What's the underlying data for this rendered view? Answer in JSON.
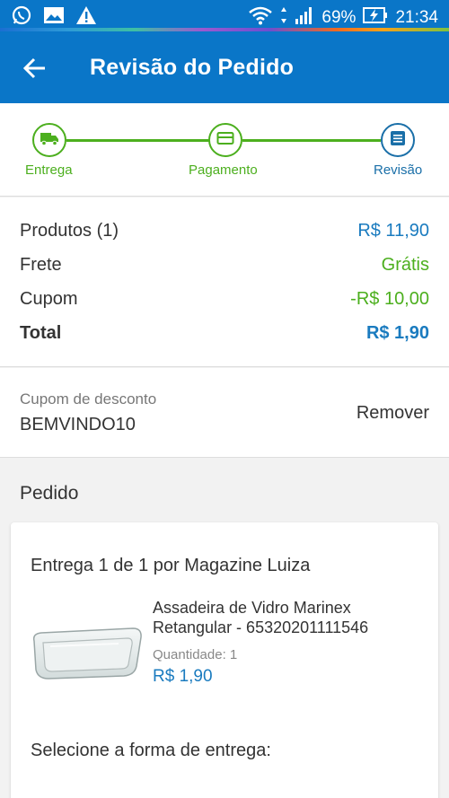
{
  "status_bar": {
    "battery": "69%",
    "time": "21:34"
  },
  "app_bar": {
    "title": "Revisão do Pedido"
  },
  "stepper": {
    "steps": [
      {
        "label": "Entrega",
        "icon": "truck-icon"
      },
      {
        "label": "Pagamento",
        "icon": "card-icon"
      },
      {
        "label": "Revisão",
        "icon": "list-icon"
      }
    ]
  },
  "summary": {
    "products_label": "Produtos (1)",
    "products_value": "R$ 11,90",
    "shipping_label": "Frete",
    "shipping_value": "Grátis",
    "coupon_label": "Cupom",
    "coupon_value": "-R$ 10,00",
    "total_label": "Total",
    "total_value": "R$ 1,90"
  },
  "coupon": {
    "label": "Cupom de desconto",
    "code": "BEMVINDO10",
    "remove_label": "Remover"
  },
  "order": {
    "section_title": "Pedido",
    "delivery_title": "Entrega 1 de 1 por Magazine Luiza",
    "product_name": "Assadeira de Vidro Marinex Retangular - 65320201111546",
    "quantity_label": "Quantidade:",
    "quantity": "1",
    "price": "R$ 1,90",
    "select_delivery_title": "Selecione a forma de entrega:"
  },
  "colors": {
    "brand_blue": "#0a76c8",
    "green": "#4caf1e",
    "price_blue": "#1a7bbf",
    "review_blue": "#1a6fa8"
  }
}
